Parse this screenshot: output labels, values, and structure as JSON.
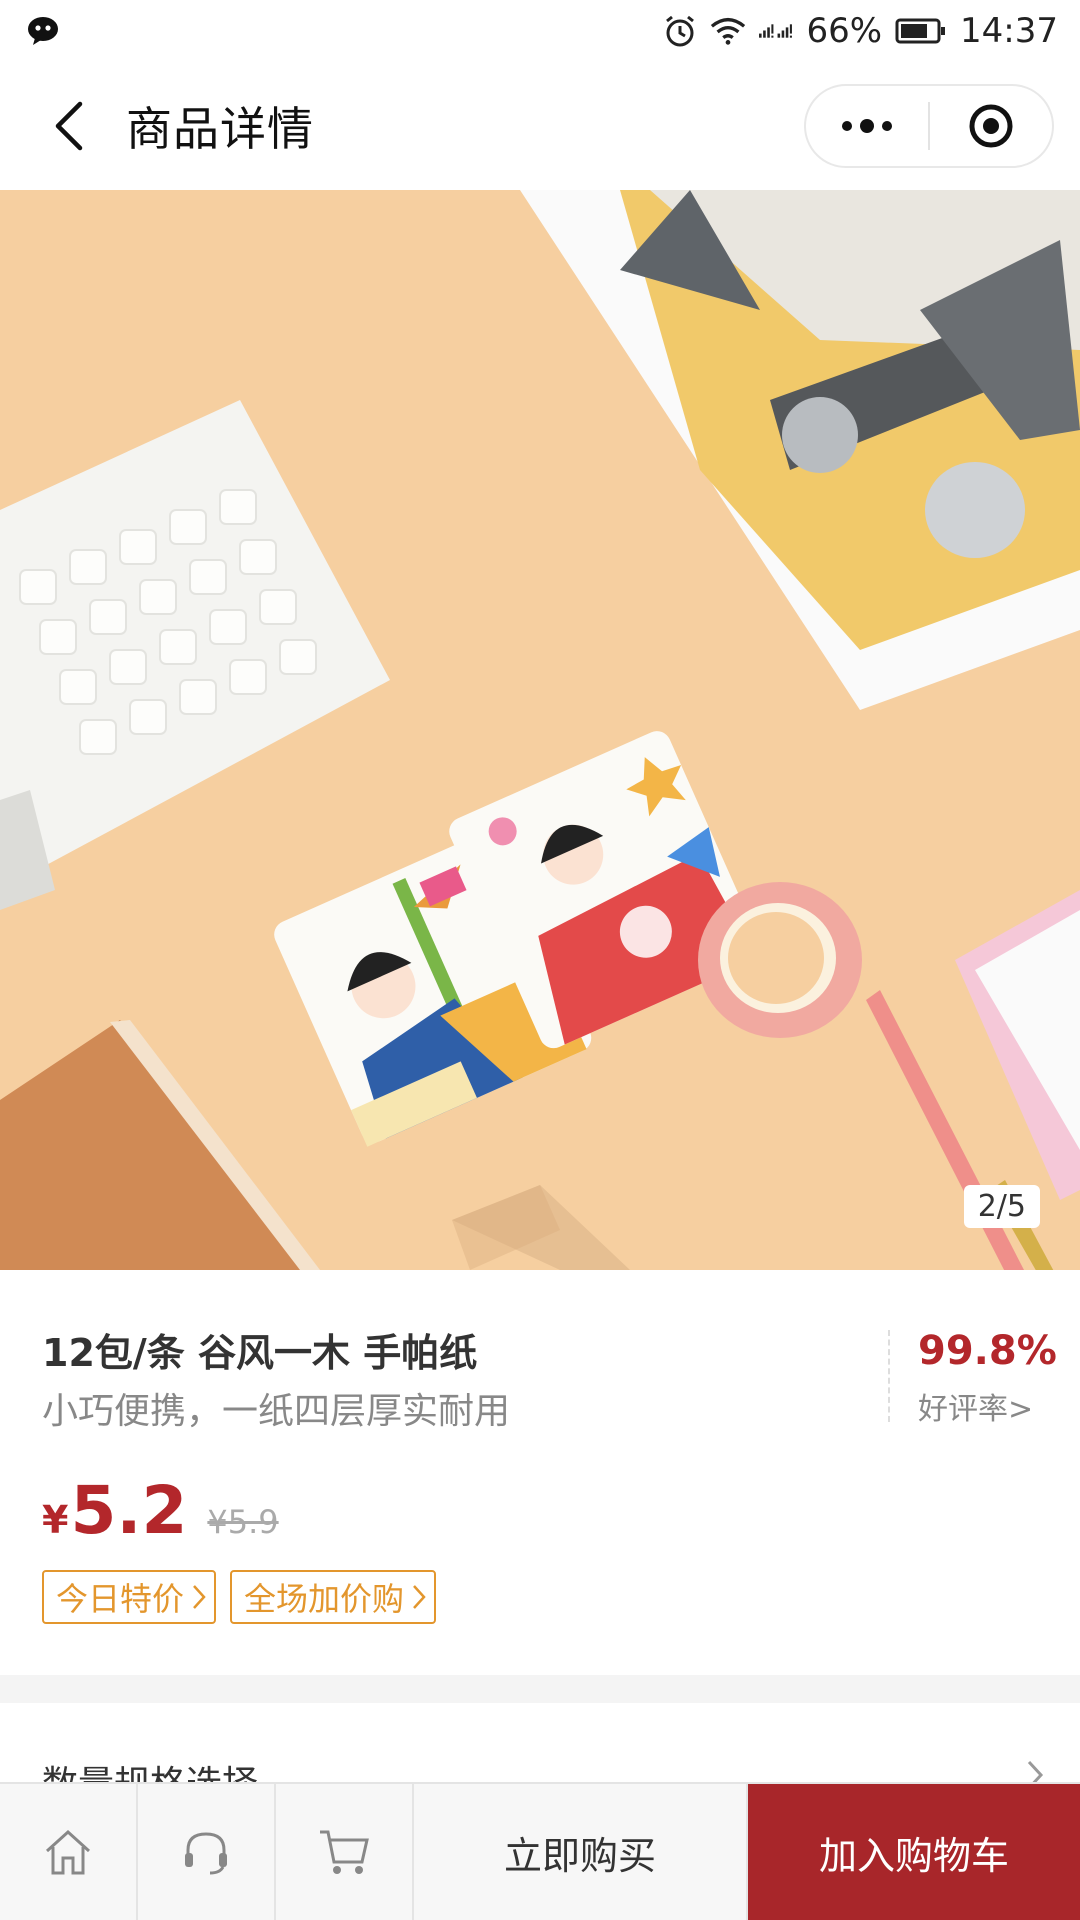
{
  "status_bar": {
    "battery": "66%",
    "time": "14:37",
    "icons": [
      "wechat-icon",
      "alarm-icon",
      "wifi-icon",
      "signal-icon",
      "battery-icon"
    ]
  },
  "nav": {
    "title": "商品详情",
    "icons": [
      "back-icon",
      "more-icon",
      "target-icon"
    ]
  },
  "gallery": {
    "page_indicator": "2/5"
  },
  "product": {
    "title": "12包/条 谷风一木 手帕纸",
    "subtitle": "小巧便携，一纸四层厚实耐用",
    "rating_value": "99.8%",
    "rating_label": "好评率>",
    "currency": "¥",
    "price": "5.2",
    "original_price": "¥5.9",
    "tags": [
      {
        "label": "今日特价"
      },
      {
        "label": "全场加价购"
      }
    ]
  },
  "spec": {
    "label": "数量规格选择"
  },
  "bottom_bar": {
    "icons": [
      "home-icon",
      "customer-service-icon",
      "cart-icon"
    ],
    "buy_now": "立即购买",
    "add_to_cart": "加入购物车"
  },
  "colors": {
    "accent_red": "#b3272b",
    "cart_button": "#a8262a",
    "tag_orange": "#e3962d",
    "photo_background": "#f6cfa0"
  }
}
